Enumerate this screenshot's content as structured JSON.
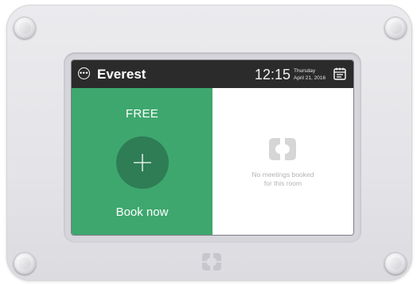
{
  "header": {
    "room_name": "Everest",
    "time": "12:15",
    "weekday": "Thursday",
    "date": "April 21, 2016",
    "menu_icon": "more-horizontal-circle-icon",
    "calendar_icon": "calendar-icon"
  },
  "status_pane": {
    "status": "FREE",
    "action_label": "Book now",
    "action_icon": "plus-icon",
    "color": "#3ea76e",
    "button_color": "#2e7d55"
  },
  "meetings_pane": {
    "empty_line1": "No meetings booked",
    "empty_line2": "for this room",
    "empty_icon": "brand-logo-icon"
  },
  "device": {
    "brand_icon": "brand-logo-icon"
  },
  "colors": {
    "topbar": "#2b2b2b",
    "free_green": "#3ea76e",
    "muted_text": "#b3b3b3"
  }
}
